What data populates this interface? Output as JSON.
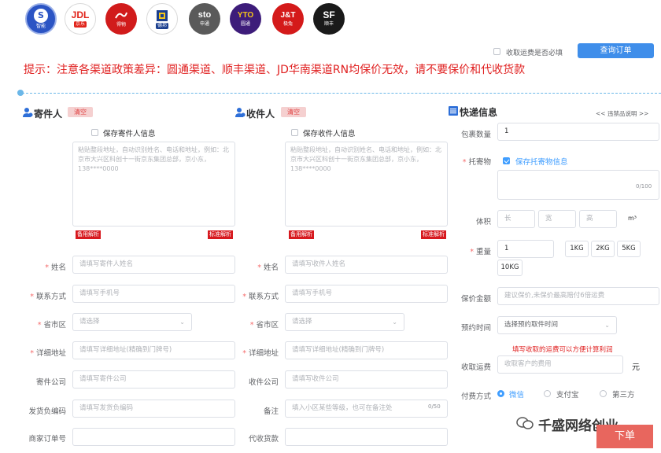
{
  "carriers": [
    {
      "name": "智能",
      "glyph": "S",
      "icon": "swirl-logo-icon"
    },
    {
      "name": "京东",
      "glyph": "JDL",
      "icon": "jdl-logo-icon"
    },
    {
      "name": "得物",
      "glyph": "",
      "icon": "deppon-logo-icon"
    },
    {
      "name": "德邦",
      "glyph": "",
      "icon": "cube-logo-icon"
    },
    {
      "name": "申通",
      "glyph": "sto",
      "icon": "sto-logo-icon"
    },
    {
      "name": "圆通",
      "glyph": "YTO",
      "icon": "yto-logo-icon"
    },
    {
      "name": "极兔",
      "glyph": "J&T",
      "icon": "jt-logo-icon"
    },
    {
      "name": "顺丰",
      "glyph": "SF",
      "icon": "sf-logo-icon"
    }
  ],
  "top_right": {
    "required_check_label": "收取运费是否必填",
    "query_button": "查询订单"
  },
  "notice": "提示：注意各渠道政策差异：圆通渠道、顺丰渠道、JD华南渠道RN均保价无效，请不要保价和代收货款",
  "sender": {
    "title": "寄件人",
    "clear": "清空",
    "save_label": "保存寄件人信息",
    "paste_placeholder": "粘贴整段地址，自动识别姓名、电话和地址，例如：北京市大兴区科创十一街京东集团总部，京小东，138****0000",
    "parse_backup": "备用解析",
    "parse_standard": "标准解析",
    "fields": [
      {
        "label": "姓名",
        "required": true,
        "placeholder": "请填写寄件人姓名"
      },
      {
        "label": "联系方式",
        "required": true,
        "placeholder": "请填写手机号"
      },
      {
        "label": "省市区",
        "required": true,
        "placeholder": "请选择"
      },
      {
        "label": "详细地址",
        "required": true,
        "placeholder": "请填写详细地址(精确到门牌号)"
      },
      {
        "label": "寄件公司",
        "required": false,
        "placeholder": "请填写寄件公司"
      },
      {
        "label": "发货负编码",
        "required": false,
        "placeholder": "请填写发货负编码"
      },
      {
        "label": "商家订单号",
        "required": false,
        "placeholder": ""
      }
    ]
  },
  "receiver": {
    "title": "收件人",
    "clear": "清空",
    "save_label": "保存收件人信息",
    "paste_placeholder": "粘贴整段地址，自动识别姓名、电话和地址，例如：北京市大兴区科创十一街京东集团总部，京小东，138****0000",
    "parse_backup": "备用解析",
    "parse_standard": "标准解析",
    "fields": [
      {
        "label": "姓名",
        "required": true,
        "placeholder": "请填写收件人姓名"
      },
      {
        "label": "联系方式",
        "required": true,
        "placeholder": "请填写手机号"
      },
      {
        "label": "省市区",
        "required": true,
        "placeholder": "请选择"
      },
      {
        "label": "详细地址",
        "required": true,
        "placeholder": "请填写详细地址(精确到门牌号)"
      },
      {
        "label": "收件公司",
        "required": false,
        "placeholder": "请填写收件公司"
      },
      {
        "label": "备注",
        "required": false,
        "placeholder": "填入小区某些等级，也可在备注处",
        "counter": "0/50"
      },
      {
        "label": "代收货款",
        "required": false,
        "placeholder": ""
      }
    ]
  },
  "express": {
    "title": "快递信息",
    "product_link": "<< 违禁品说明 >>",
    "package_count_label": "包裹数量",
    "package_count_value": "1",
    "goods_label": "托寄物",
    "goods_save_label": "保存托寄物信息",
    "goods_counter": "0/100",
    "volume_label": "体积",
    "volume_placeholders": [
      "长",
      "宽",
      "高"
    ],
    "volume_unit": "m³",
    "weight_label": "重量",
    "weight_value": "1",
    "weight_buttons": [
      "1KG",
      "2KG",
      "5KG",
      "10KG"
    ],
    "insure_label": "保价金额",
    "insure_placeholder": "建议保价,未保价最高赔付6倍运费",
    "pickup_label": "预约时间",
    "pickup_placeholder": "选择预约取件时间",
    "fee_hint": "填写收取的运费可以方便计算利润",
    "fee_label": "收取运费",
    "fee_placeholder": "收取客户的费用",
    "fee_unit": "元",
    "pay_label": "付费方式",
    "pay_options": [
      "微信",
      "支付宝",
      "第三方"
    ]
  },
  "watermark": "千盛网络创业",
  "submit": "下单",
  "colors": {
    "accent": "#409eff",
    "notice_red": "#e02020",
    "tag_red": "#d7191f"
  }
}
